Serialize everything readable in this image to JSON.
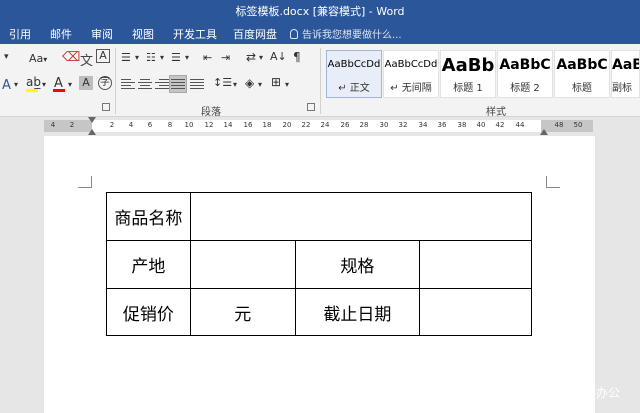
{
  "titlebar": {
    "title": "标签模板.docx [兼容模式] - Word"
  },
  "menu": {
    "tabs": [
      "引用",
      "邮件",
      "审阅",
      "视图",
      "开发工具",
      "百度网盘"
    ],
    "tell_me": "告诉我您想要做什么..."
  },
  "ribbon": {
    "font": {
      "aa_label": "Aa",
      "clear_format_label": "A",
      "font_color_label": "A",
      "char_shade_label": "A",
      "char_border_label": "A"
    },
    "paragraph": {
      "group_label": "段落"
    },
    "styles": {
      "group_label": "样式",
      "items": [
        {
          "sample": "AaBbCcDd",
          "name": "↵ 正文",
          "selected": true
        },
        {
          "sample": "AaBbCcDd",
          "name": "↵ 无间隔",
          "selected": false
        },
        {
          "sample": "AaBb",
          "name": "标题 1",
          "selected": false
        },
        {
          "sample": "AaBbC",
          "name": "标题 2",
          "selected": false
        },
        {
          "sample": "AaBbC",
          "name": "标题",
          "selected": false
        },
        {
          "sample": "AaBbC",
          "name": "副标",
          "selected": false
        }
      ]
    },
    "colors": {
      "accent": "#2b579a",
      "highlight": "#ffff00",
      "font_color": "#ff0000"
    }
  },
  "ruler": {
    "left_numbers": [
      "4",
      "2"
    ],
    "numbers": [
      "2",
      "4",
      "6",
      "8",
      "10",
      "12",
      "14",
      "16",
      "18",
      "20",
      "22",
      "24",
      "26",
      "28",
      "30",
      "32",
      "34",
      "36",
      "38",
      "40",
      "42",
      "44"
    ],
    "right_numbers": [
      "48",
      "50"
    ]
  },
  "document": {
    "table": {
      "row1": {
        "c1": "商品名称",
        "c2": ""
      },
      "row2": {
        "c1": "产地",
        "c2": "",
        "c3": "规格",
        "c4": ""
      },
      "row3": {
        "c1": "促销价",
        "c2": "元",
        "c3": "截止日期",
        "c4": ""
      }
    }
  },
  "watermark": "办公"
}
